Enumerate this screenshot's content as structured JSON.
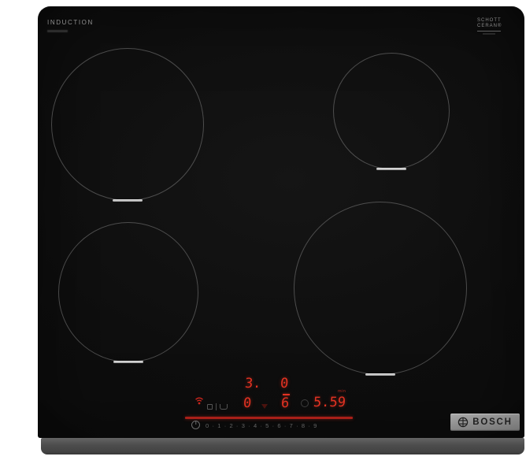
{
  "colors": {
    "display_red": "#e23222",
    "slider_red": "#a81f18",
    "glass_black": "#0d0d0d",
    "trim_gray": "#4a4a4a"
  },
  "surface": {
    "type_label": "INDUCTION",
    "glass_brand_line1": "SCHOTT",
    "glass_brand_line2": "CERAN®"
  },
  "brand": {
    "name": "BOSCH"
  },
  "controls": {
    "zone_displays": {
      "rear_left": "3.",
      "rear_right": "0",
      "front_left": "0",
      "front_right": "6"
    },
    "timer": {
      "value": "5.59",
      "unit": "min"
    },
    "power_scale": "0 · 1 · 2 · 3 · 4 · 5 · 6 · 7 · 8 · 9",
    "icons": {
      "home_connect": "wifi-icon",
      "clock": "clock-icon",
      "power": "power-icon",
      "child_lock": "lock-icon",
      "divider": "divider",
      "pan_support": "pan-icon",
      "pan_detect": "pan-detect-icon"
    }
  }
}
